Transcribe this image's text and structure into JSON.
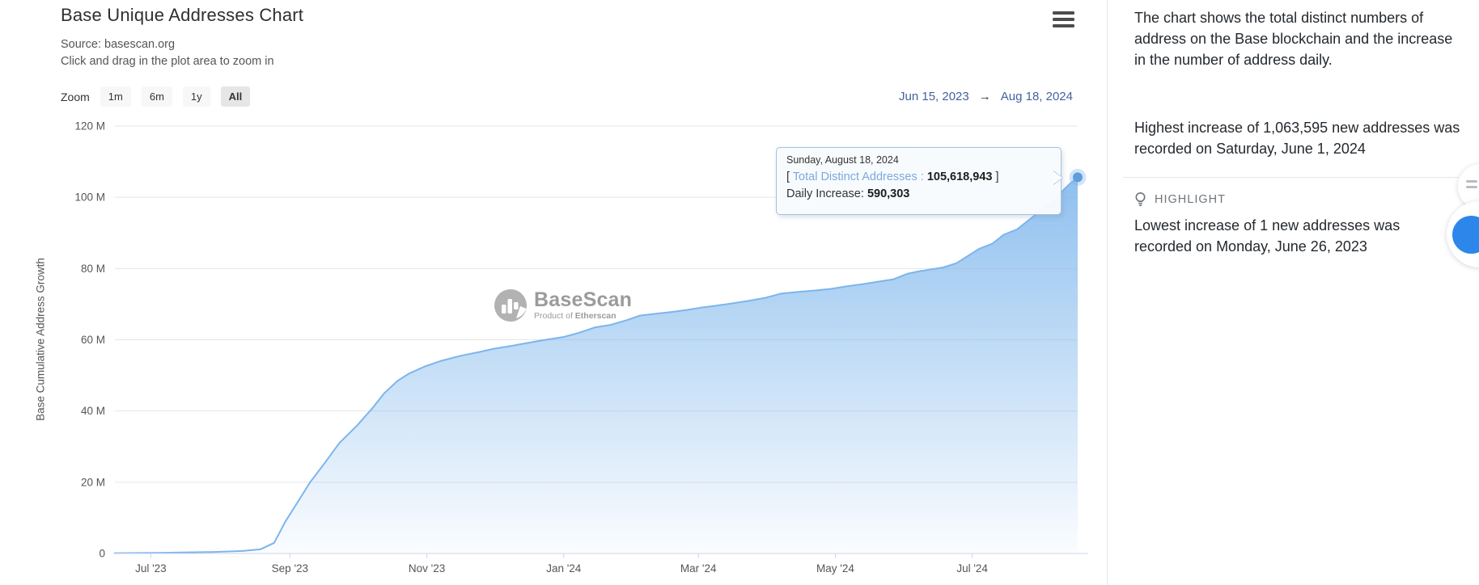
{
  "header": {
    "title": "Base Unique Addresses Chart",
    "source": "Source: basescan.org",
    "hint": "Click and drag in the plot area to zoom in",
    "menu_icon": "hamburger-icon"
  },
  "toolbar": {
    "zoom_label": "Zoom",
    "buttons": [
      {
        "label": "1m",
        "selected": false
      },
      {
        "label": "6m",
        "selected": false
      },
      {
        "label": "1y",
        "selected": false
      },
      {
        "label": "All",
        "selected": true
      }
    ],
    "range_from": "Jun 15, 2023",
    "range_arrow": "→",
    "range_to": "Aug 18, 2024"
  },
  "tooltip": {
    "date": "Sunday, August 18, 2024",
    "line2": [
      {
        "t": "[ "
      },
      {
        "t": "Total Distinct Addresses",
        "c": "blue"
      },
      {
        "t": " : ",
        "c": "blue"
      },
      {
        "t": "105,618,943",
        "b": true
      },
      {
        "t": " ]"
      }
    ],
    "line3": [
      {
        "t": "Daily Increase: "
      },
      {
        "t": "590,303",
        "b": true
      }
    ]
  },
  "watermark": {
    "name": "BaseScan",
    "tagline_prefix": "Product of ",
    "tagline_bold": "Etherscan",
    "icon": "basescan-bar-chart-logo"
  },
  "panel": {
    "description": "The chart shows the total distinct numbers of address on the Base blockchain and the increase in the number of address daily.",
    "highest": [
      {
        "t": "Highest increase of "
      },
      {
        "t": "1,063,595",
        "b": true
      },
      {
        "t": " new addresses was recorded on Saturday, June 1, 2024"
      }
    ],
    "highlight_icon": "lightbulb-icon",
    "highlight_label": "HIGHLIGHT",
    "lowest": [
      {
        "t": "Lowest increase of "
      },
      {
        "t": "1",
        "b": true
      },
      {
        "t": " new addresses was recorded on Monday, June 26, 2023"
      }
    ]
  },
  "colors": {
    "series_blue": "#7cb5ec",
    "marker_blue": "#5f9ddb",
    "date_link_blue": "#44629f",
    "grid": "#e6e6e6",
    "axis": "#ccd6eb",
    "floating_button_blue": "#2d87ea"
  },
  "chart_data": {
    "type": "area",
    "title": "Base Unique Addresses Chart",
    "xlabel": "",
    "ylabel": "Base Cumulative Address Growth",
    "x_unit": "days since Jun 15, 2023",
    "x_start_label": "Jun 15, 2023",
    "x_end_label": "Aug 18, 2024",
    "total_days": 429,
    "ylim_millions": [
      0,
      120
    ],
    "grid": true,
    "legend": false,
    "yticks": [
      {
        "value": 0,
        "label": "0"
      },
      {
        "value": 20,
        "label": "20 M"
      },
      {
        "value": 40,
        "label": "40 M"
      },
      {
        "value": 60,
        "label": "60 M"
      },
      {
        "value": 80,
        "label": "80 M"
      },
      {
        "value": 100,
        "label": "100 M"
      },
      {
        "value": 120,
        "label": "120 M"
      }
    ],
    "xticks": [
      {
        "day": 16,
        "label": "Jul '23"
      },
      {
        "day": 78,
        "label": "Sep '23"
      },
      {
        "day": 139,
        "label": "Nov '23"
      },
      {
        "day": 200,
        "label": "Jan '24"
      },
      {
        "day": 260,
        "label": "Mar '24"
      },
      {
        "day": 321,
        "label": "May '24"
      },
      {
        "day": 382,
        "label": "Jul '24"
      }
    ],
    "points_day_millions": [
      [
        0,
        0.1
      ],
      [
        21,
        0.2
      ],
      [
        43,
        0.4
      ],
      [
        57,
        0.7
      ],
      [
        65,
        1.2
      ],
      [
        71,
        3
      ],
      [
        76,
        9
      ],
      [
        82,
        15
      ],
      [
        87,
        20
      ],
      [
        93,
        25
      ],
      [
        100,
        31
      ],
      [
        108,
        36
      ],
      [
        115,
        41
      ],
      [
        120,
        45
      ],
      [
        126,
        48.5
      ],
      [
        131,
        50.5
      ],
      [
        138,
        52.5
      ],
      [
        145,
        54
      ],
      [
        154,
        55.5
      ],
      [
        162,
        56.5
      ],
      [
        169,
        57.5
      ],
      [
        176,
        58.2
      ],
      [
        183,
        59
      ],
      [
        190,
        59.8
      ],
      [
        200,
        60.8
      ],
      [
        207,
        62
      ],
      [
        214,
        63.5
      ],
      [
        221,
        64.2
      ],
      [
        228,
        65.5
      ],
      [
        234,
        66.8
      ],
      [
        241,
        67.3
      ],
      [
        248,
        67.8
      ],
      [
        255,
        68.4
      ],
      [
        261,
        69
      ],
      [
        268,
        69.6
      ],
      [
        275,
        70.2
      ],
      [
        283,
        71
      ],
      [
        290,
        71.8
      ],
      [
        297,
        73
      ],
      [
        304,
        73.4
      ],
      [
        311,
        73.8
      ],
      [
        319,
        74.3
      ],
      [
        326,
        75
      ],
      [
        333,
        75.6
      ],
      [
        340,
        76.3
      ],
      [
        347,
        77
      ],
      [
        353,
        78.5
      ],
      [
        358,
        79.2
      ],
      [
        364,
        79.8
      ],
      [
        369,
        80.3
      ],
      [
        375,
        81.5
      ],
      [
        380,
        83.5
      ],
      [
        385,
        85.5
      ],
      [
        391,
        87
      ],
      [
        396,
        89.5
      ],
      [
        402,
        91
      ],
      [
        407,
        93.5
      ],
      [
        412,
        96
      ],
      [
        418,
        99
      ],
      [
        421,
        101
      ],
      [
        425,
        103.5
      ],
      [
        429,
        105.618943
      ]
    ],
    "last_point": {
      "label": "Sunday, August 18, 2024",
      "total_distinct_addresses": 105618943,
      "daily_increase": 590303
    }
  }
}
